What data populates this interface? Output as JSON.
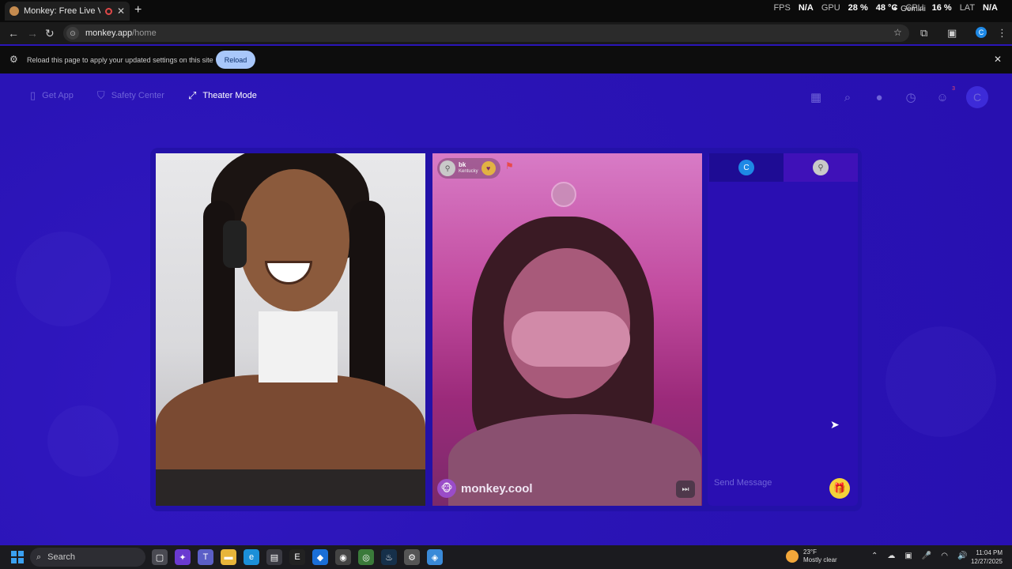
{
  "browser": {
    "tab_title": "Monkey: Free Live Video Ch",
    "tab_close": "✕",
    "new_tab": "+",
    "url_domain": "monkey.app",
    "url_path": "/home",
    "perf": {
      "fps_label": "FPS",
      "fps_value": "N/A",
      "gpu_label": "GPU",
      "gpu_value": "28 %",
      "gpu_temp": "48 °C",
      "cpu_label": "CPU",
      "cpu_value": "16 %",
      "lat_label": "LAT",
      "lat_value": "N/A",
      "gemini": "Gemini"
    },
    "infobar": {
      "message": "Reload this page to apply your updated settings on this site",
      "reload_label": "Reload"
    }
  },
  "page": {
    "nav": [
      {
        "label": "Get App",
        "icon": "phone-icon"
      },
      {
        "label": "Safety Center",
        "icon": "shield-icon"
      },
      {
        "label": "Theater Mode",
        "icon": "expand-icon"
      }
    ],
    "notification_badge": "3",
    "avatar_initial": "C",
    "remote_user": {
      "name": "bk",
      "location": "Kentucky"
    },
    "watermark": "monkey.cool",
    "chat": {
      "self_initial": "C",
      "placeholder": "Send Message"
    }
  },
  "taskbar": {
    "search_label": "Search",
    "weather_temp": "23°F",
    "weather_desc": "Mostly clear",
    "time": "11:04 PM",
    "date": "12/27/2025"
  },
  "colors": {
    "page_bg": "#2a14b6",
    "stage_bg": "#2311a8",
    "reload_btn": "#a8c7fa",
    "gift": "#f5d23a"
  }
}
